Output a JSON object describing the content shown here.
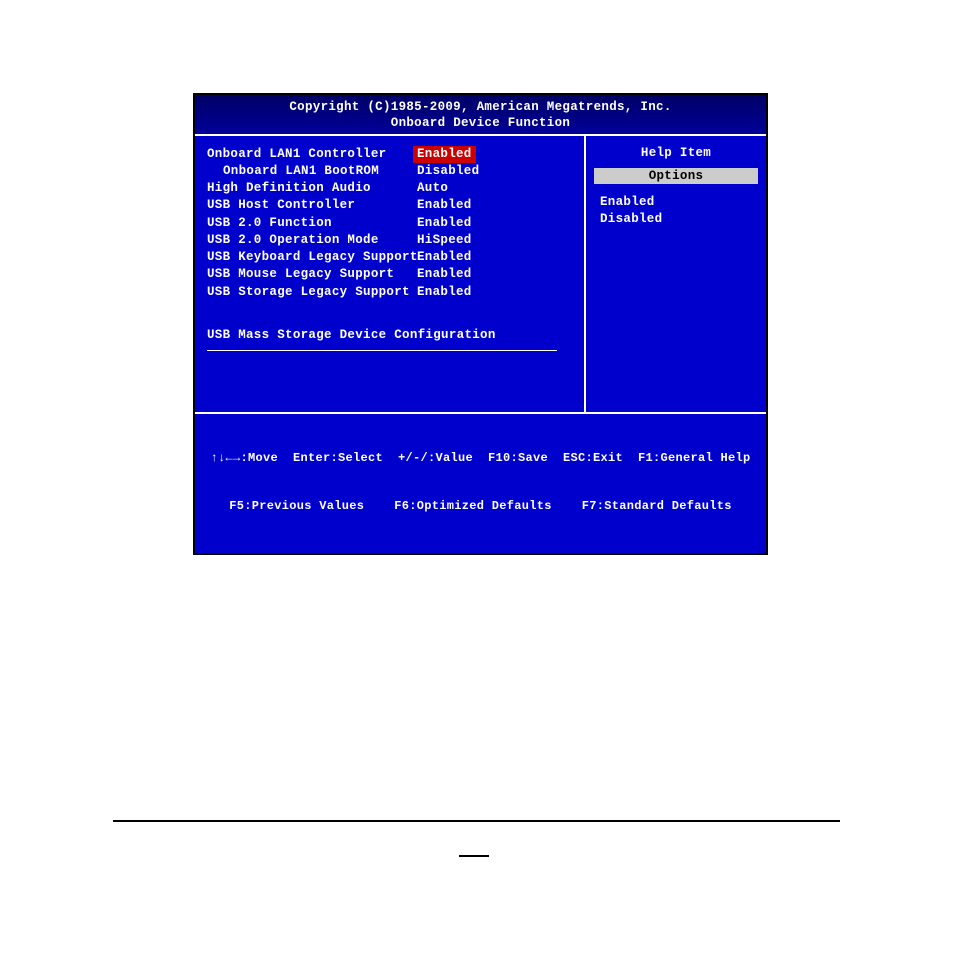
{
  "header": {
    "copyright": "Copyright (C)1985-2009, American Megatrends, Inc.",
    "page_title": "Onboard Device Function"
  },
  "options": [
    {
      "label": "Onboard LAN1 Controller",
      "value": "Enabled",
      "indent": false,
      "selected": true
    },
    {
      "label": "Onboard LAN1 BootROM",
      "value": "Disabled",
      "indent": true,
      "selected": false
    },
    {
      "label": "High Definition Audio",
      "value": "Auto",
      "indent": false,
      "selected": false
    },
    {
      "label": "USB Host Controller",
      "value": "Enabled",
      "indent": false,
      "selected": false
    },
    {
      "label": "USB 2.0 Function",
      "value": "Enabled",
      "indent": false,
      "selected": false
    },
    {
      "label": "USB 2.0 Operation Mode",
      "value": "HiSpeed",
      "indent": false,
      "selected": false
    },
    {
      "label": "USB Keyboard Legacy Support",
      "value": "Enabled",
      "indent": false,
      "selected": false
    },
    {
      "label": "USB Mouse Legacy Support",
      "value": "Enabled",
      "indent": false,
      "selected": false
    },
    {
      "label": "USB Storage Legacy Support",
      "value": "Enabled",
      "indent": false,
      "selected": false
    }
  ],
  "section_header": "USB Mass Storage Device Configuration",
  "help": {
    "title": "Help Item",
    "options_label": "Options",
    "values": [
      "Enabled",
      "Disabled"
    ]
  },
  "footer": {
    "line1": "↑↓←→:Move  Enter:Select  +/-/:Value  F10:Save  ESC:Exit  F1:General Help",
    "line2": "F5:Previous Values    F6:Optimized Defaults    F7:Standard Defaults"
  }
}
